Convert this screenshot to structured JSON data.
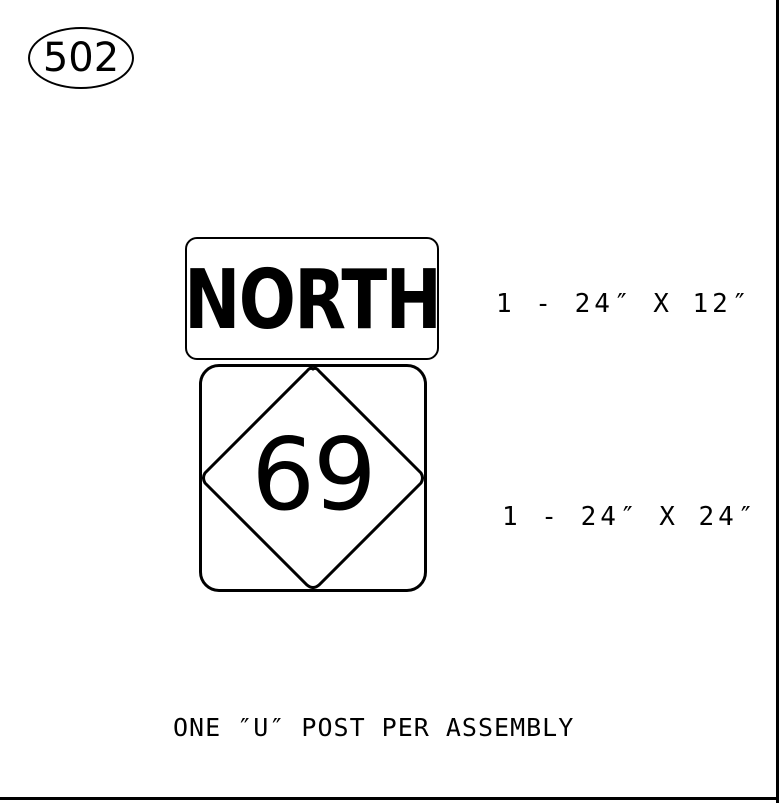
{
  "assembly_number": "502",
  "signs": [
    {
      "legend": "NORTH",
      "size": "1 - 24″ X 12″"
    },
    {
      "legend": "69",
      "size": "1 - 24″ X 24″"
    }
  ],
  "note": "ONE ″U″ POST PER ASSEMBLY"
}
